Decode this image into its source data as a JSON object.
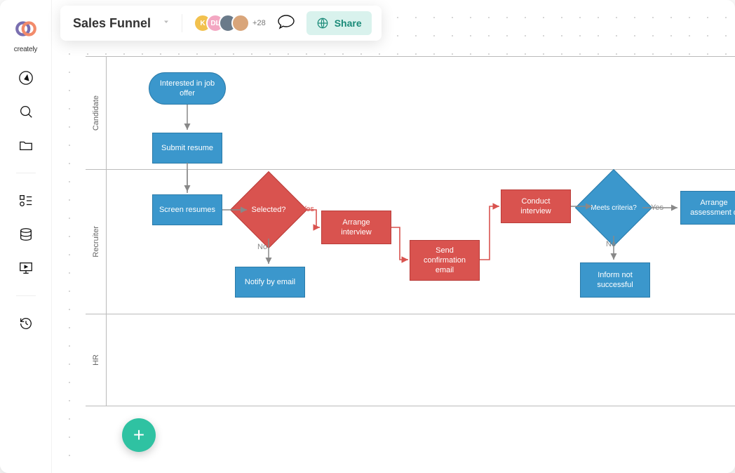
{
  "brand": {
    "name": "creately"
  },
  "doc": {
    "title": "Sales Funnel"
  },
  "collab": {
    "avatars": [
      {
        "initial": "K",
        "bg": "#f2c14e"
      },
      {
        "initial": "DL",
        "bg": "#f3a7c2"
      },
      {
        "initial": "",
        "bg": "#6a7a8a"
      },
      {
        "initial": "",
        "bg": "#d9a57a"
      }
    ],
    "more_count": "+28"
  },
  "share": {
    "label": "Share"
  },
  "lanes": {
    "candidate": "Candidate",
    "recruiter": "Recruiter",
    "hr": "HR"
  },
  "nodes": {
    "interested": "Interested in job offer",
    "submit_resume": "Submit resume",
    "screen_resumes": "Screen resumes",
    "selected": "Selected?",
    "notify_email": "Notify by email",
    "arrange_interview": "Arrange interview",
    "send_confirmation": "Send confirmation email",
    "conduct_interview": "Conduct interview",
    "meets_criteria": "Meets criteria?",
    "inform_not_successful": "Inform not successful",
    "arrange_assessment": "Arrange assessment d"
  },
  "edge_labels": {
    "yes1": "Yes",
    "no1": "No",
    "yes2": "Yes",
    "no2": "No"
  },
  "fab": {
    "label": "+"
  }
}
